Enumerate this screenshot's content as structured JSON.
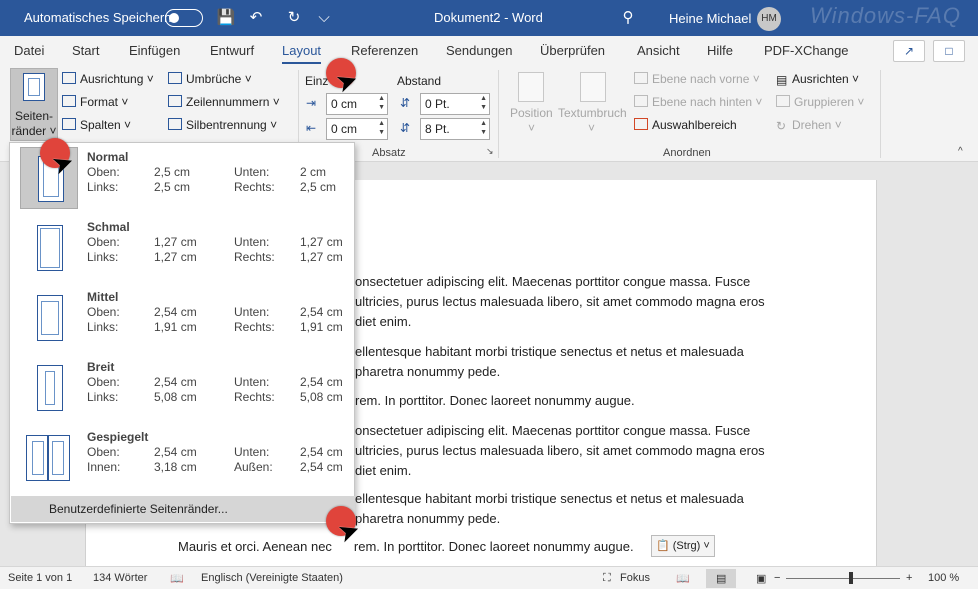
{
  "titlebar": {
    "autosave_label": "Automatisches Speichern",
    "doc_title": "Dokument2  -  Word",
    "user_name": "Heine Michael",
    "user_initials": "HM",
    "watermark": "Windows-FAQ",
    "accent": "#2b579a"
  },
  "tabs": [
    {
      "label": "Datei"
    },
    {
      "label": "Start"
    },
    {
      "label": "Einfügen"
    },
    {
      "label": "Entwurf"
    },
    {
      "label": "Layout"
    },
    {
      "label": "Referenzen"
    },
    {
      "label": "Sendungen"
    },
    {
      "label": "Überprüfen"
    },
    {
      "label": "Ansicht"
    },
    {
      "label": "Hilfe"
    },
    {
      "label": "PDF-XChange"
    }
  ],
  "ribbon": {
    "seitenraender_label_1": "Seiten-",
    "seitenraender_label_2": "ränder",
    "ausrichtung": "Ausrichtung",
    "format": "Format",
    "spalten": "Spalten",
    "umbrueche": "Umbrüche",
    "zeilennummern": "Zeilennummern",
    "silbentrennung": "Silbentrennung",
    "einzug_label": "Einz",
    "abstand_label": "Abstand",
    "einzug_links": "0 cm",
    "einzug_rechts": "0 cm",
    "abstand_vor": "0 Pt.",
    "abstand_nach": "8 Pt.",
    "absatz_group": "Absatz",
    "position": "Position",
    "textumbruch": "Textumbruch",
    "ebene_vorne": "Ebene nach vorne",
    "ebene_hinten": "Ebene nach hinten",
    "auswahlbereich": "Auswahlbereich",
    "ausrichten": "Ausrichten",
    "gruppieren": "Gruppieren",
    "drehen": "Drehen",
    "anordnen_group": "Anordnen"
  },
  "margins_menu": {
    "options": [
      {
        "title": "Normal",
        "l1": "Oben:",
        "v1": "2,5 cm",
        "l2": "Unten:",
        "v2": "2 cm",
        "l3": "Links:",
        "v3": "2,5 cm",
        "l4": "Rechts:",
        "v4": "2,5 cm"
      },
      {
        "title": "Schmal",
        "l1": "Oben:",
        "v1": "1,27 cm",
        "l2": "Unten:",
        "v2": "1,27 cm",
        "l3": "Links:",
        "v3": "1,27 cm",
        "l4": "Rechts:",
        "v4": "1,27 cm"
      },
      {
        "title": "Mittel",
        "l1": "Oben:",
        "v1": "2,54 cm",
        "l2": "Unten:",
        "v2": "2,54 cm",
        "l3": "Links:",
        "v3": "1,91 cm",
        "l4": "Rechts:",
        "v4": "1,91 cm"
      },
      {
        "title": "Breit",
        "l1": "Oben:",
        "v1": "2,54 cm",
        "l2": "Unten:",
        "v2": "2,54 cm",
        "l3": "Links:",
        "v3": "5,08 cm",
        "l4": "Rechts:",
        "v4": "5,08 cm"
      },
      {
        "title": "Gespiegelt",
        "l1": "Oben:",
        "v1": "2,54 cm",
        "l2": "Unten:",
        "v2": "2,54 cm",
        "l3": "Innen:",
        "v3": "3,18 cm",
        "l4": "Außen:",
        "v4": "2,54 cm"
      }
    ],
    "custom": "Benutzerdefinierte Seitenränder..."
  },
  "document": {
    "p1a": "onsectetuer adipiscing elit. Maecenas porttitor congue massa. Fusce",
    "p1b": "ultricies, purus lectus malesuada libero, sit amet commodo magna eros",
    "p1c": "diet enim.",
    "p2a": "ellentesque habitant morbi tristique senectus et netus et malesuada",
    "p2b": "pharetra nonummy pede.",
    "p3": "rem. In porttitor. Donec laoreet nonummy augue.",
    "p4a": "onsectetuer adipiscing elit. Maecenas porttitor congue massa. Fusce",
    "p4b": "ultricies, purus lectus malesuada libero, sit amet commodo magna eros",
    "p4c": "diet enim.",
    "p5a": "ellentesque habitant morbi tristique senectus et netus et malesuada",
    "p5b": "pharetra nonummy pede.",
    "last_left": "Mauris et orci. Aenean nec",
    "last_right": "rem. In porttitor. Donec laoreet nonummy augue.",
    "paste_label": "(Strg)"
  },
  "status": {
    "page": "Seite 1 von 1",
    "words": "134 Wörter",
    "language": "Englisch (Vereinigte Staaten)",
    "focus": "Fokus",
    "zoom": "100 %"
  }
}
